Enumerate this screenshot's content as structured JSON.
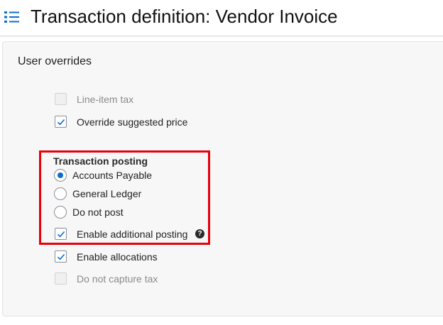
{
  "header": {
    "title": "Transaction definition: Vendor Invoice",
    "menu_icon": "menu-list-icon"
  },
  "section": {
    "title": "User overrides"
  },
  "options": {
    "line_item_tax": {
      "label": "Line-item tax",
      "checked": false,
      "disabled": true
    },
    "override_suggested_price": {
      "label": "Override suggested price",
      "checked": true,
      "disabled": false
    },
    "enable_allocations": {
      "label": "Enable allocations",
      "checked": true,
      "disabled": false
    },
    "do_not_capture_tax": {
      "label": "Do not capture tax",
      "checked": false,
      "disabled": true
    }
  },
  "transaction_posting": {
    "title": "Transaction posting",
    "radios": [
      {
        "label": "Accounts Payable",
        "selected": true
      },
      {
        "label": "General Ledger",
        "selected": false
      },
      {
        "label": "Do not post",
        "selected": false
      }
    ],
    "enable_additional_posting": {
      "label": "Enable additional posting",
      "checked": true
    },
    "help_glyph": "?"
  },
  "colors": {
    "accent": "#0a6ed1",
    "highlight": "#e8000b",
    "panel_bg": "#f7f7f8"
  }
}
